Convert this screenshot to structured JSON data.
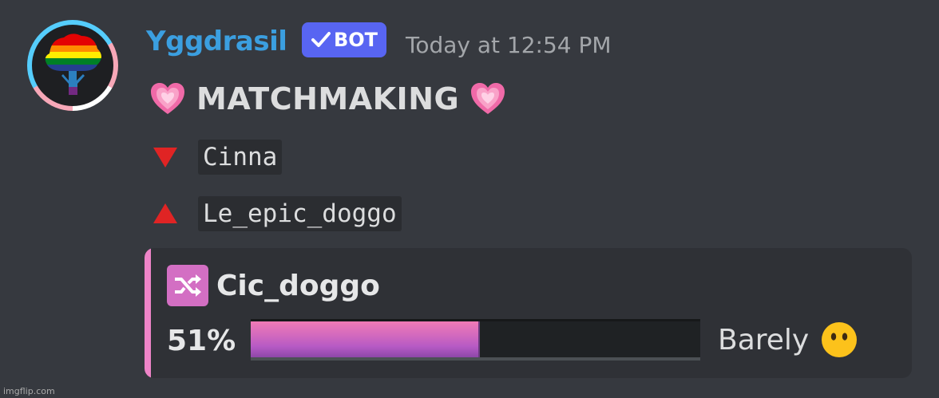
{
  "message": {
    "username": "Yggdrasil",
    "bot_badge": "BOT",
    "timestamp": "Today at 12:54 PM",
    "title": "MATCHMAKING",
    "user_one": "Cinna",
    "user_two": "Le_epic_doggo"
  },
  "embed": {
    "name": "Cic_doggo",
    "percent_label": "51%",
    "match_percent": 51,
    "rating": "Barely",
    "accent_color": "#ee84c8"
  },
  "icons": {
    "heart": "growing-heart-emoji",
    "down": "red-down-triangle-emoji",
    "up": "red-up-triangle-emoji",
    "shuffle": "shuffle-icon",
    "rating_emoji": "face-without-mouth-emoji"
  },
  "colors": {
    "background": "#36393f",
    "username": "#3b9fe0",
    "badge": "#5865f2",
    "embed_bg": "#2f3136"
  },
  "watermark": "imgflip.com"
}
